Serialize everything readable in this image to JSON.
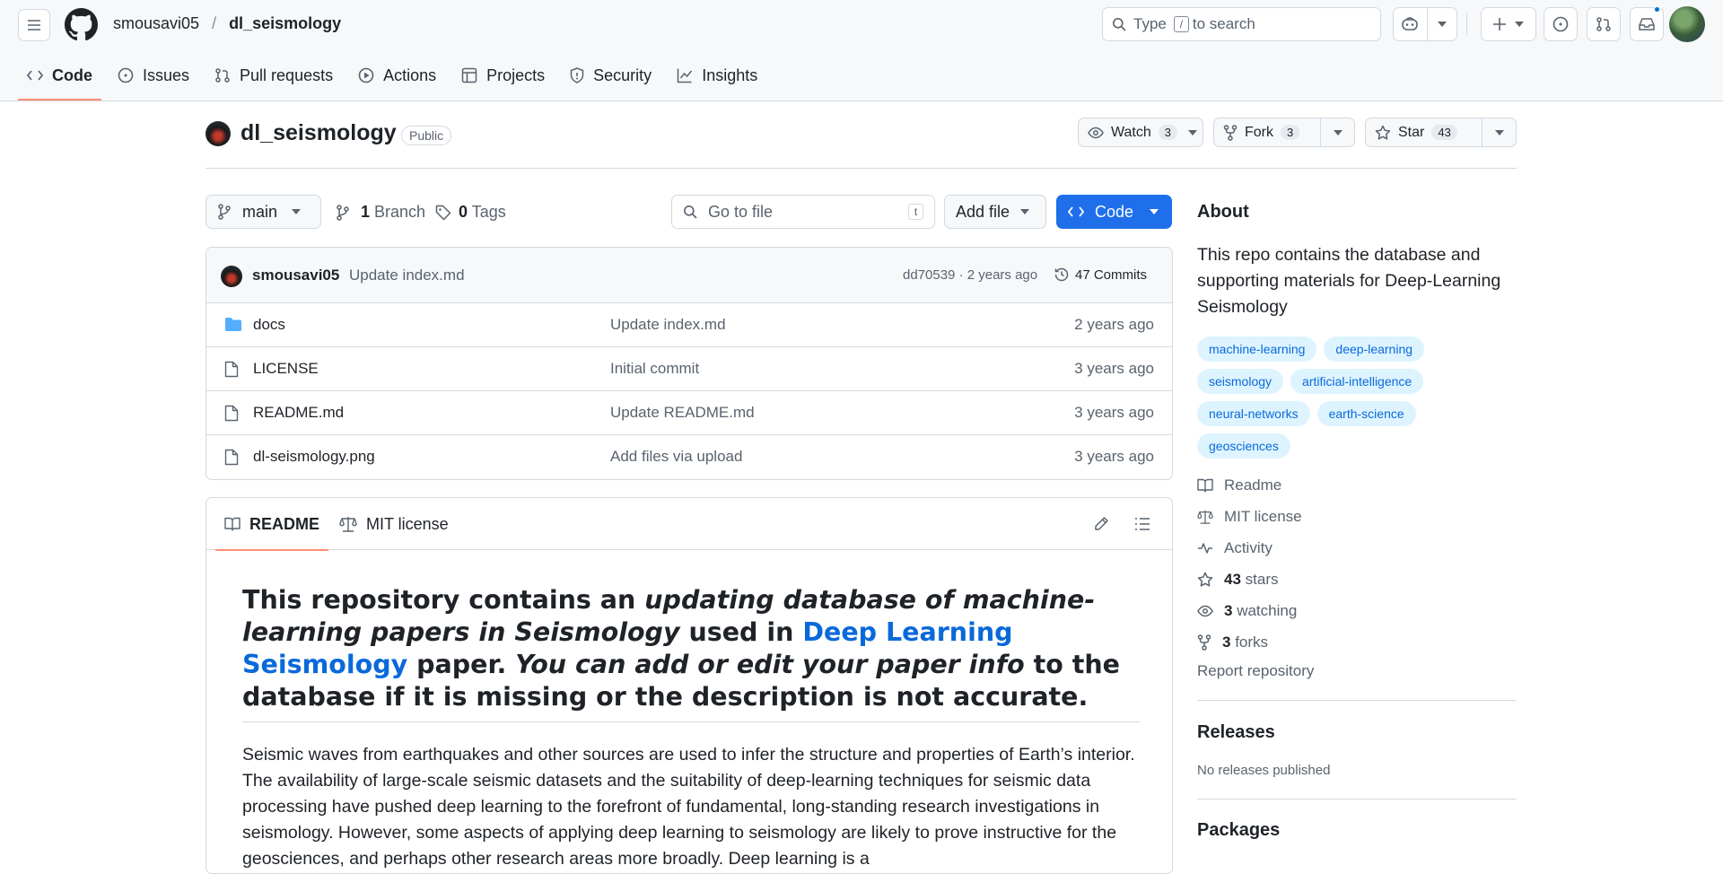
{
  "header": {
    "owner": "smousavi05",
    "separator": "/",
    "repo": "dl_seismology",
    "search_prefix": "Type",
    "search_key": "/",
    "search_suffix": "to search"
  },
  "tabs": [
    {
      "label": "Code",
      "icon": "code-icon",
      "active": true
    },
    {
      "label": "Issues",
      "icon": "issue-icon"
    },
    {
      "label": "Pull requests",
      "icon": "pull-request-icon"
    },
    {
      "label": "Actions",
      "icon": "play-icon"
    },
    {
      "label": "Projects",
      "icon": "table-icon"
    },
    {
      "label": "Security",
      "icon": "shield-icon"
    },
    {
      "label": "Insights",
      "icon": "graph-icon"
    }
  ],
  "repo": {
    "name": "dl_seismology",
    "visibility": "Public",
    "watch_label": "Watch",
    "watch_count": "3",
    "fork_label": "Fork",
    "fork_count": "3",
    "star_label": "Star",
    "star_count": "43"
  },
  "toolbar": {
    "branch": "main",
    "branch_count": "1",
    "branch_label": "Branch",
    "tag_count": "0",
    "tag_label": "Tags",
    "goto_placeholder": "Go to file",
    "goto_key": "t",
    "add_file": "Add file",
    "code": "Code"
  },
  "commit": {
    "author": "smousavi05",
    "message": "Update index.md",
    "hash_time": "dd70539 · 2 years ago",
    "commits": "47 Commits"
  },
  "files": [
    {
      "name": "docs",
      "type": "folder",
      "message": "Update index.md",
      "date": "2 years ago"
    },
    {
      "name": "LICENSE",
      "type": "file",
      "message": "Initial commit",
      "date": "3 years ago"
    },
    {
      "name": "README.md",
      "type": "file",
      "message": "Update README.md",
      "date": "3 years ago"
    },
    {
      "name": "dl-seismology.png",
      "type": "file",
      "message": "Add files via upload",
      "date": "3 years ago"
    }
  ],
  "readme": {
    "tab_readme": "README",
    "tab_license": "MIT license",
    "h1_part1": "This repository contains an ",
    "h1_part2": "updating database of machine-learning papers in Seismology",
    "h1_part3": " used in ",
    "h1_link": "Deep Learning Seismology",
    "h1_part4": " paper. ",
    "h1_part5": "You can add or edit your paper info",
    "h1_part6": " to the database if it is missing or the description is not accurate.",
    "paragraph": "Seismic waves from earthquakes and other sources are used to infer the structure and properties of Earth’s interior. The availability of large-scale seismic datasets and the suitability of deep-learning techniques for seismic data processing have pushed deep learning to the forefront of fundamental, long-standing research investigations in seismology. However, some aspects of applying deep learning to seismology are likely to prove instructive for the geosciences, and perhaps other research areas more broadly. Deep learning is a"
  },
  "about": {
    "title": "About",
    "description": "This repo contains the database and supporting materials for Deep-Learning Seismology",
    "topics": [
      "machine-learning",
      "deep-learning",
      "seismology",
      "artificial-intelligence",
      "neural-networks",
      "earth-science",
      "geosciences"
    ],
    "readme": "Readme",
    "license": "MIT license",
    "activity": "Activity",
    "stars_count": "43",
    "stars_label": "stars",
    "watching_count": "3",
    "watching_label": "watching",
    "forks_count": "3",
    "forks_label": "forks",
    "report": "Report repository"
  },
  "releases": {
    "title": "Releases",
    "text": "No releases published"
  },
  "packages": {
    "title": "Packages"
  },
  "colors": {
    "accent": "#1f6feb",
    "link": "#0969da",
    "tab_underline": "#fd8c73",
    "folder": "#54aeff"
  }
}
